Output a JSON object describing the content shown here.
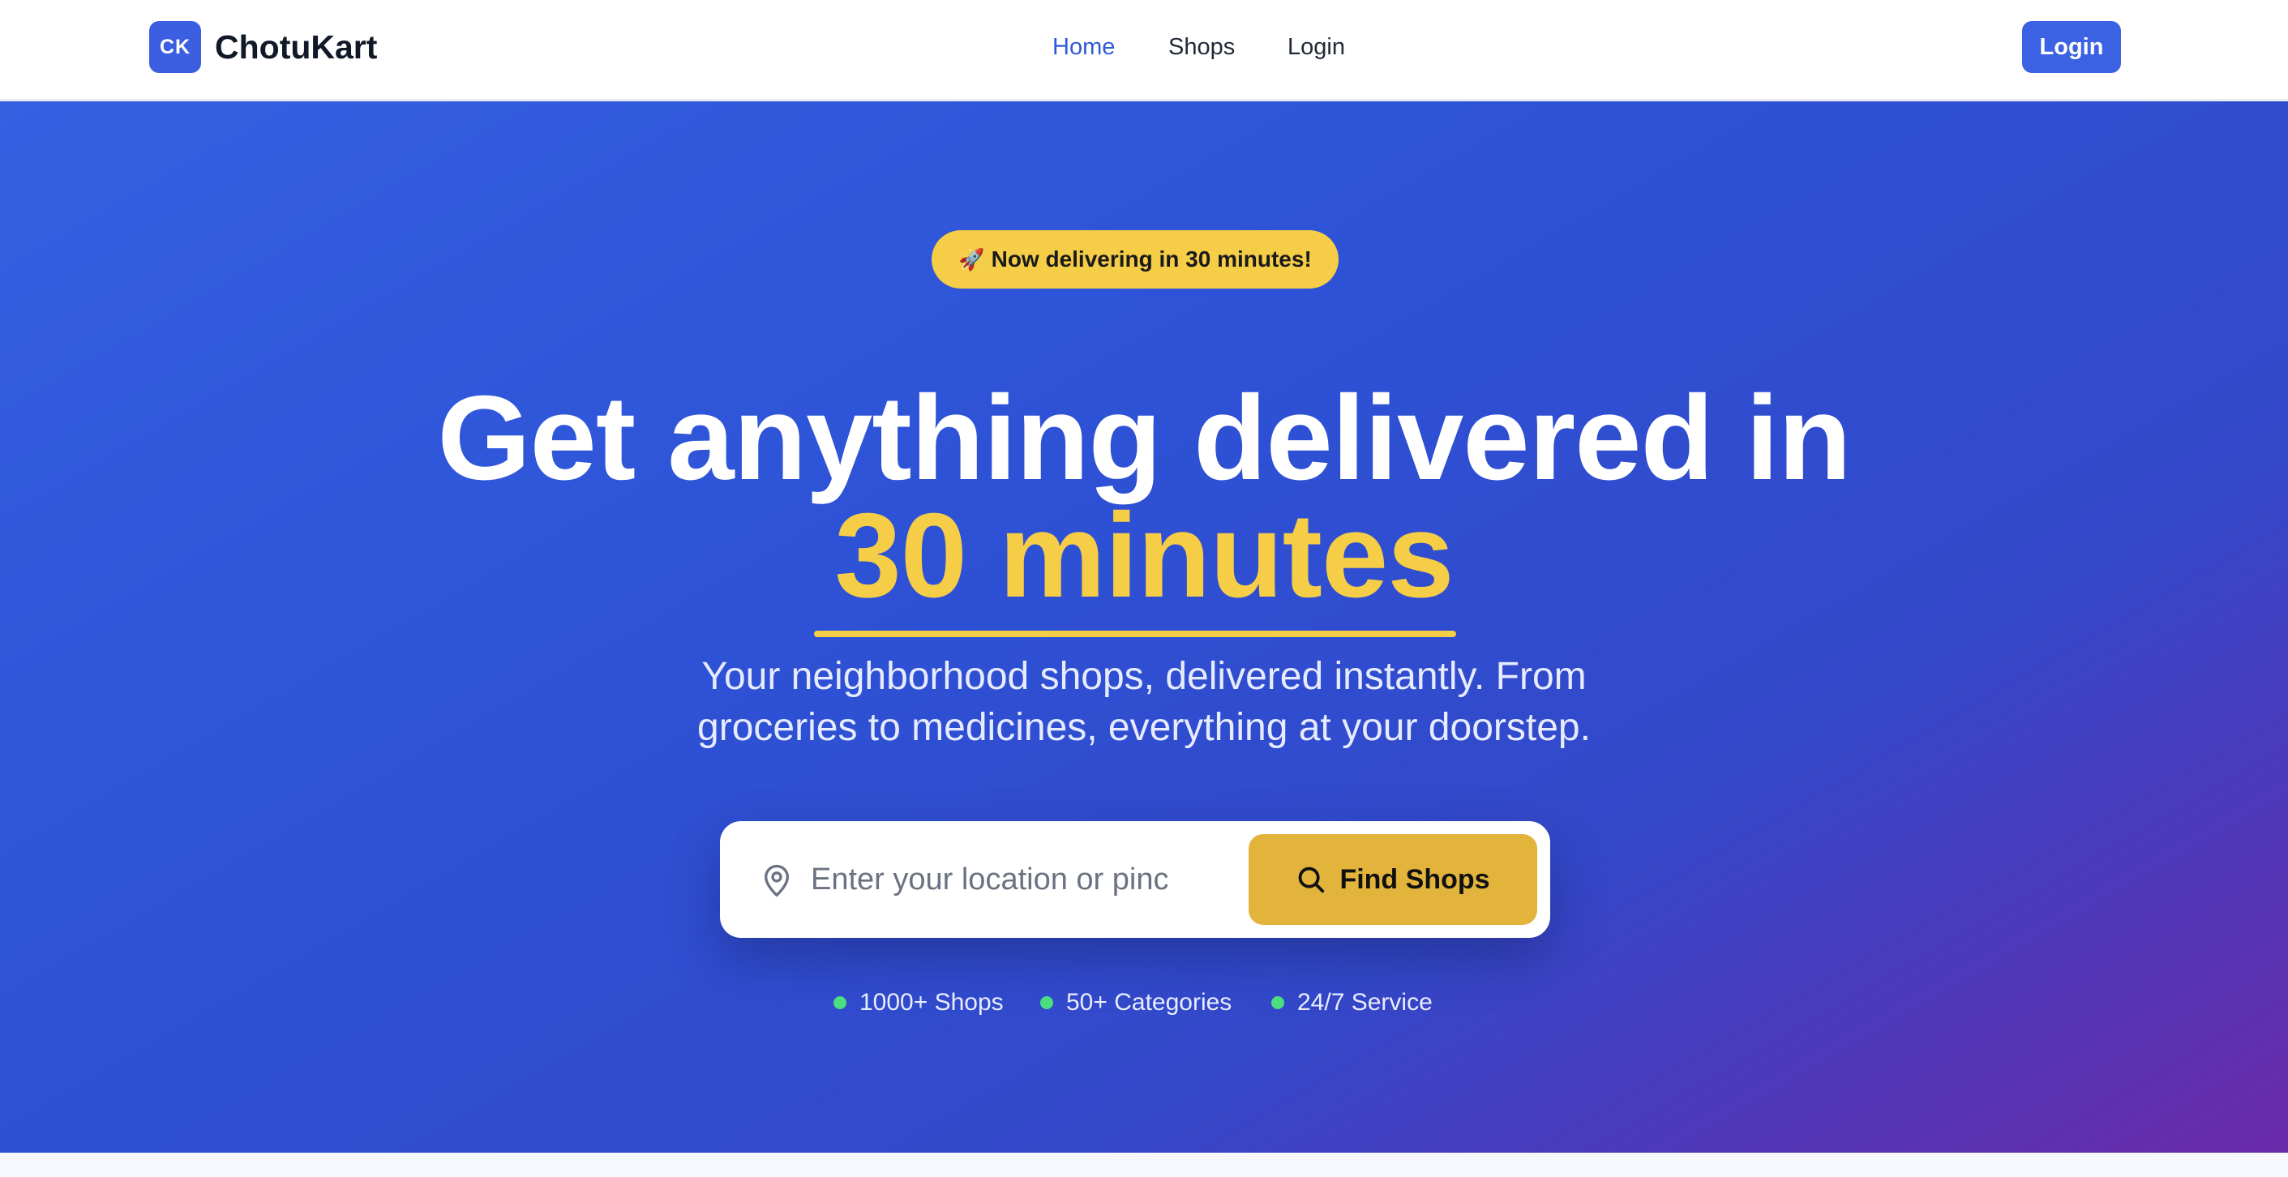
{
  "brand": {
    "mark": "CK",
    "name": "ChotuKart"
  },
  "nav": {
    "home": "Home",
    "shops": "Shops",
    "login": "Login"
  },
  "header": {
    "login_button": "Login"
  },
  "hero": {
    "badge": "Now delivering in 30 minutes!",
    "badge_icon": "rocket-icon",
    "headline_line1": "Get anything delivered in",
    "headline_highlight": "30 minutes",
    "subtext_line1": "Your neighborhood shops, delivered instantly. From",
    "subtext_line2": "groceries to medicines, everything at your doorstep."
  },
  "search": {
    "placeholder": "Enter your location or pincode",
    "button_label": "Find Shops",
    "location_icon": "map-pin-icon",
    "button_icon": "search-icon"
  },
  "stats": [
    {
      "label": "1000+ Shops"
    },
    {
      "label": "50+ Categories"
    },
    {
      "label": "24/7 Service"
    }
  ],
  "colors": {
    "brand_blue": "#3b5fe0",
    "accent_yellow": "#f5cd46",
    "button_yellow": "#e2b43c",
    "status_green": "#4ade80",
    "hero_gradient_start": "#365fe2",
    "hero_gradient_end": "#6a2aaa"
  }
}
